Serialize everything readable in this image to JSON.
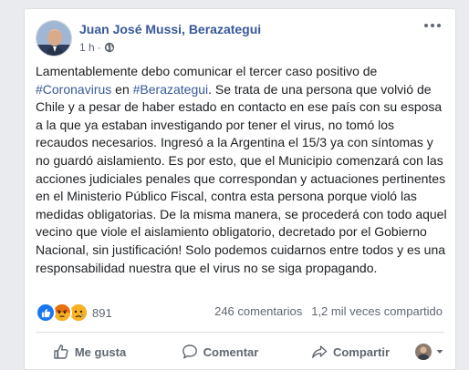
{
  "post": {
    "author": "Juan José Mussi, Berazategui",
    "time": "1 h",
    "separator": "·",
    "avatar_icon": "profile-photo",
    "privacy_icon": "globe-icon",
    "text": {
      "p1": "Lamentablemente debo comunicar el tercer caso positivo de ",
      "hashtag1": "#Coronavirus",
      "p2": " en ",
      "hashtag2": "#Berazategui",
      "p3": ". Se trata de una persona que volvió de Chile y a pesar de haber estado en contacto en ese país con su esposa a la que ya estaban investigando por tener el virus, no tomó los recaudos necesarios. Ingresó a la Argentina el 15/3 ya con síntomas y no guardó aislamiento. Es por esto, que el Municipio comenzará con las acciones judiciales penales que correspondan y actuaciones pertinentes en el Ministerio Público Fiscal, contra esta persona porque violó las medidas obligatorias. De la misma manera, se procederá con todo aquel vecino que viole el aislamiento obligatorio, decretado por el Gobierno Nacional, sin justificación! Solo podemos cuidarnos entre todos y es una responsabilidad nuestra que el virus no se siga propagando."
    }
  },
  "reactions": {
    "icons": [
      "like-icon",
      "angry-icon",
      "sad-icon"
    ],
    "count": "891"
  },
  "stats": {
    "comments": "246 comentarios",
    "shares": "1,2 mil veces compartido"
  },
  "actions": {
    "like": "Me gusta",
    "comment": "Comentar",
    "share": "Compartir"
  },
  "colors": {
    "link": "#385898",
    "text": "#1c1e21",
    "secondary": "#606770",
    "like_blue": "#1877f2",
    "angry_red": "#e9710f",
    "sad_yellow": "#f7b125"
  }
}
